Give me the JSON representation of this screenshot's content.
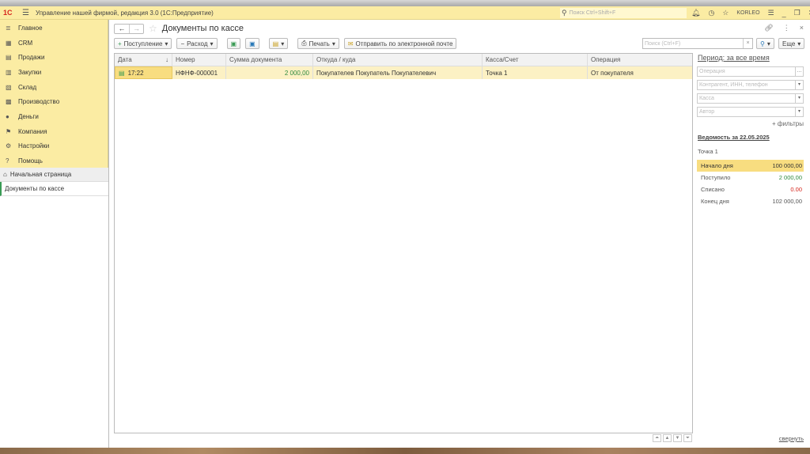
{
  "app": {
    "logo": "1С",
    "title": "Управление нашей фирмой, редакция 3.0  (1С:Предприятие)",
    "search_placeholder": "Поиск Ctrl+Shift+F",
    "user": "KORLEO"
  },
  "sidebar": {
    "items": [
      {
        "label": "Главное",
        "icon": "≣"
      },
      {
        "label": "CRM",
        "icon": "▦"
      },
      {
        "label": "Продажи",
        "icon": "▤"
      },
      {
        "label": "Закупки",
        "icon": "▥"
      },
      {
        "label": "Склад",
        "icon": "▧"
      },
      {
        "label": "Производство",
        "icon": "▩"
      },
      {
        "label": "Деньги",
        "icon": "●"
      },
      {
        "label": "Компания",
        "icon": "⚑"
      },
      {
        "label": "Настройки",
        "icon": "⚙"
      },
      {
        "label": "Помощь",
        "icon": "?"
      }
    ],
    "home": "Начальная страница",
    "open_doc": "Документы по кассе"
  },
  "page": {
    "title": "Документы по кассе"
  },
  "toolbar": {
    "income": "Поступление",
    "expense": "Расход",
    "print": "Печать",
    "email": "Отправить по электронной почте",
    "search_placeholder": "Поиск (Ctrl+F)",
    "more": "Еще"
  },
  "table": {
    "columns": [
      "Дата",
      "Номер",
      "Сумма документа",
      "Откуда / куда",
      "Касса/Счет",
      "Операция"
    ],
    "rows": [
      [
        "17:22",
        "НФНФ-000001",
        "2 000,00",
        "Покупателев Покупатель Покупателевич",
        "Точка 1",
        "От покупателя"
      ]
    ]
  },
  "filters": {
    "period": "Период: за все время",
    "operation": "Операция",
    "counterparty": "Контрагент, ИНН, телефон",
    "cash": "Касса",
    "author": "Автор",
    "more_filters": "+ фильтры"
  },
  "statement": {
    "title": "Ведомость за 22.05.2025",
    "point": "Точка 1",
    "rows": [
      {
        "label": "Начало дня",
        "value": "100 000,00"
      },
      {
        "label": "Поступило",
        "value": "2 000,00"
      },
      {
        "label": "Списано",
        "value": "0.00"
      },
      {
        "label": "Конец дня",
        "value": "102 000,00"
      }
    ],
    "collapse": "свернуть"
  }
}
